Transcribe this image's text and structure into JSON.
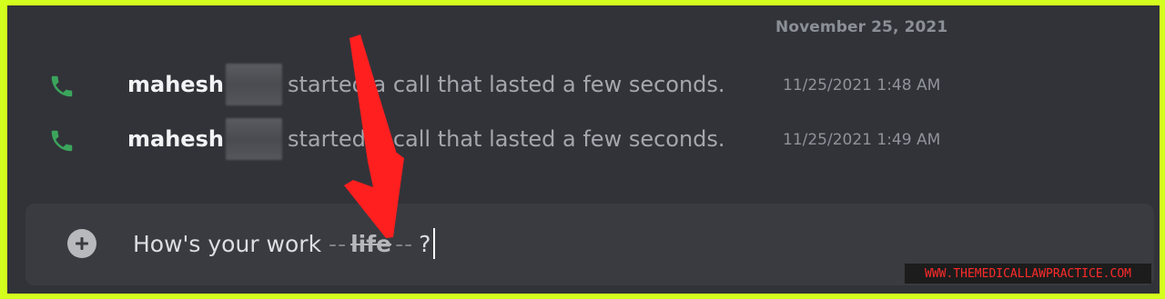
{
  "date_divider": "November 25, 2021",
  "messages": [
    {
      "icon": "phone-icon",
      "author": "mahesh",
      "text": "started a call that lasted a few seconds.",
      "timestamp": "11/25/2021 1:48 AM"
    },
    {
      "icon": "phone-icon",
      "author": "mahesh",
      "text": "started a call that lasted a few seconds.",
      "timestamp": "11/25/2021 1:49 AM"
    }
  ],
  "composer": {
    "text_before": "How's your work",
    "dashes_left": "--",
    "strike_text": "life",
    "dashes_right": "--",
    "text_after": "?"
  },
  "watermark": "WWW.THEMEDICALLAWPRACTICE.COM",
  "colors": {
    "border": "#d4ff1e",
    "background": "#323339",
    "phone_icon": "#3ba55c",
    "arrow": "#ff1f1f"
  }
}
